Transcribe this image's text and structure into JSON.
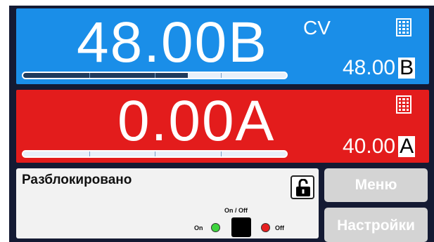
{
  "voltage": {
    "actual_value": "48.00В",
    "mode": "CV",
    "set_value": "48.00",
    "set_unit": "В",
    "bar_fraction": 0.625,
    "color": "#1a8ee8"
  },
  "current": {
    "actual_value": "0.00А",
    "set_value": "40.00",
    "set_unit": "А",
    "bar_fraction": 0.0,
    "color": "#e31c1c"
  },
  "status": {
    "text": "Разблокировано",
    "lock_icon": "unlocked-padlock-icon",
    "onoff_title": "On / Off",
    "on_label": "On",
    "off_label": "Off",
    "on_led_color": "#3ed43e",
    "off_led_color": "#e62020"
  },
  "buttons": {
    "menu_label": "Меню",
    "settings_label": "Настройки"
  },
  "icons": {
    "keypad": "keypad-grid-icon"
  }
}
